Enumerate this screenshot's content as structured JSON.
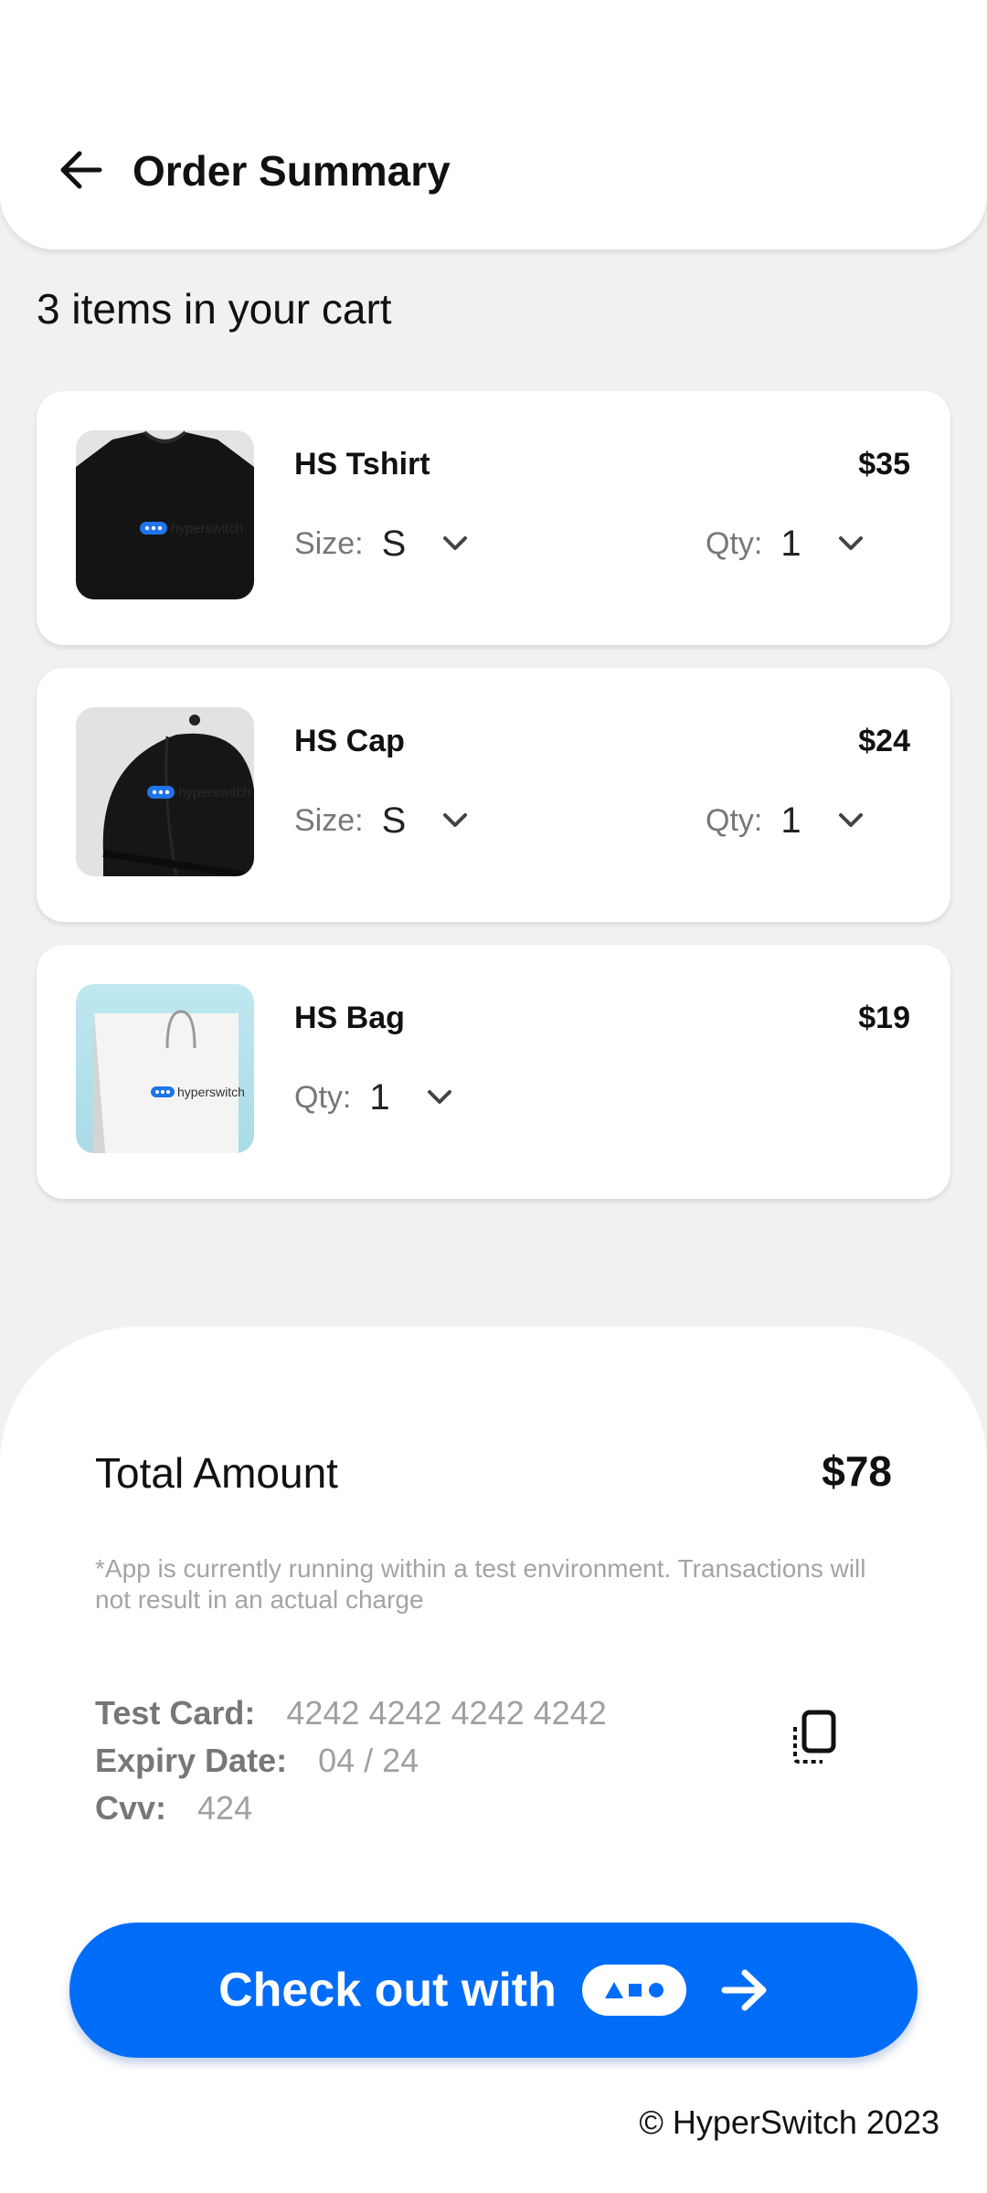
{
  "header": {
    "title": "Order Summary",
    "back_icon": "arrow-left-icon"
  },
  "cart": {
    "count_text": "3 items in your cart",
    "items": [
      {
        "name": "HS Tshirt",
        "price": "$35",
        "size_label": "Size:",
        "size_value": "S",
        "qty_label": "Qty:",
        "qty_value": "1",
        "image_text": "hyperswitch"
      },
      {
        "name": "HS Cap",
        "price": "$24",
        "size_label": "Size:",
        "size_value": "S",
        "qty_label": "Qty:",
        "qty_value": "1",
        "image_text": "hyperswitch"
      },
      {
        "name": "HS Bag",
        "price": "$19",
        "qty_label": "Qty:",
        "qty_value": "1",
        "image_text": "hyperswitch"
      }
    ]
  },
  "summary": {
    "total_label": "Total Amount",
    "total_value": "$78",
    "notice": "*App is currently running within a test environment. Transactions will not result in an actual charge",
    "test_card_label": "Test Card:",
    "test_card_value": "4242 4242 4242 4242",
    "expiry_label": "Expiry Date:",
    "expiry_value": "04 / 24",
    "cvv_label": "Cvv:",
    "cvv_value": "424",
    "copy_icon": "copy-icon"
  },
  "checkout": {
    "label": "Check out with",
    "arrow_icon": "arrow-right-icon"
  },
  "footer": {
    "text": "© HyperSwitch 2023"
  },
  "colors": {
    "accent": "#006df9",
    "background": "#f1f1f1",
    "card": "#ffffff"
  }
}
